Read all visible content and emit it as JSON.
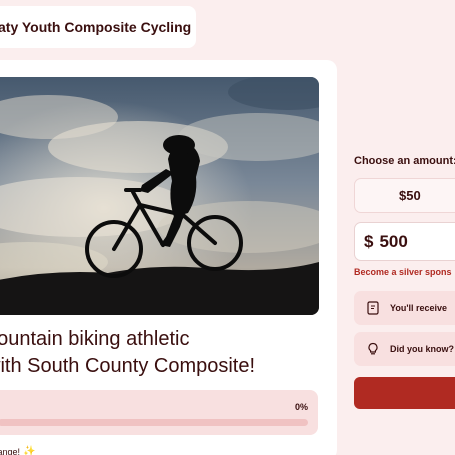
{
  "header": {
    "org_name": "aty Youth Composite Cycling"
  },
  "campaign": {
    "title_line1": "nountain biking athletic",
    "title_line2": "with South County Composite!",
    "progress_pct_label": "0%",
    "progress_fraction": 0,
    "cta_text": "Change!"
  },
  "donation": {
    "choose_label": "Choose an amount:",
    "preset_amount": "$50",
    "currency_symbol": "$",
    "custom_amount": "500",
    "tier_message": "Become a silver spons",
    "info_receive": "You'll receive",
    "info_did_you_know": "Did you know?"
  },
  "icons": {
    "hero": "cyclist-silhouette-image",
    "sparkle": "sparkle-icon",
    "receipt": "receipt-icon",
    "lightbulb": "lightbulb-icon"
  },
  "colors": {
    "background": "#fbeeee",
    "text": "#3a0f0f",
    "accent": "#b02a22",
    "progress_track": "#f0c2c2",
    "panel": "#f8e0e0"
  }
}
